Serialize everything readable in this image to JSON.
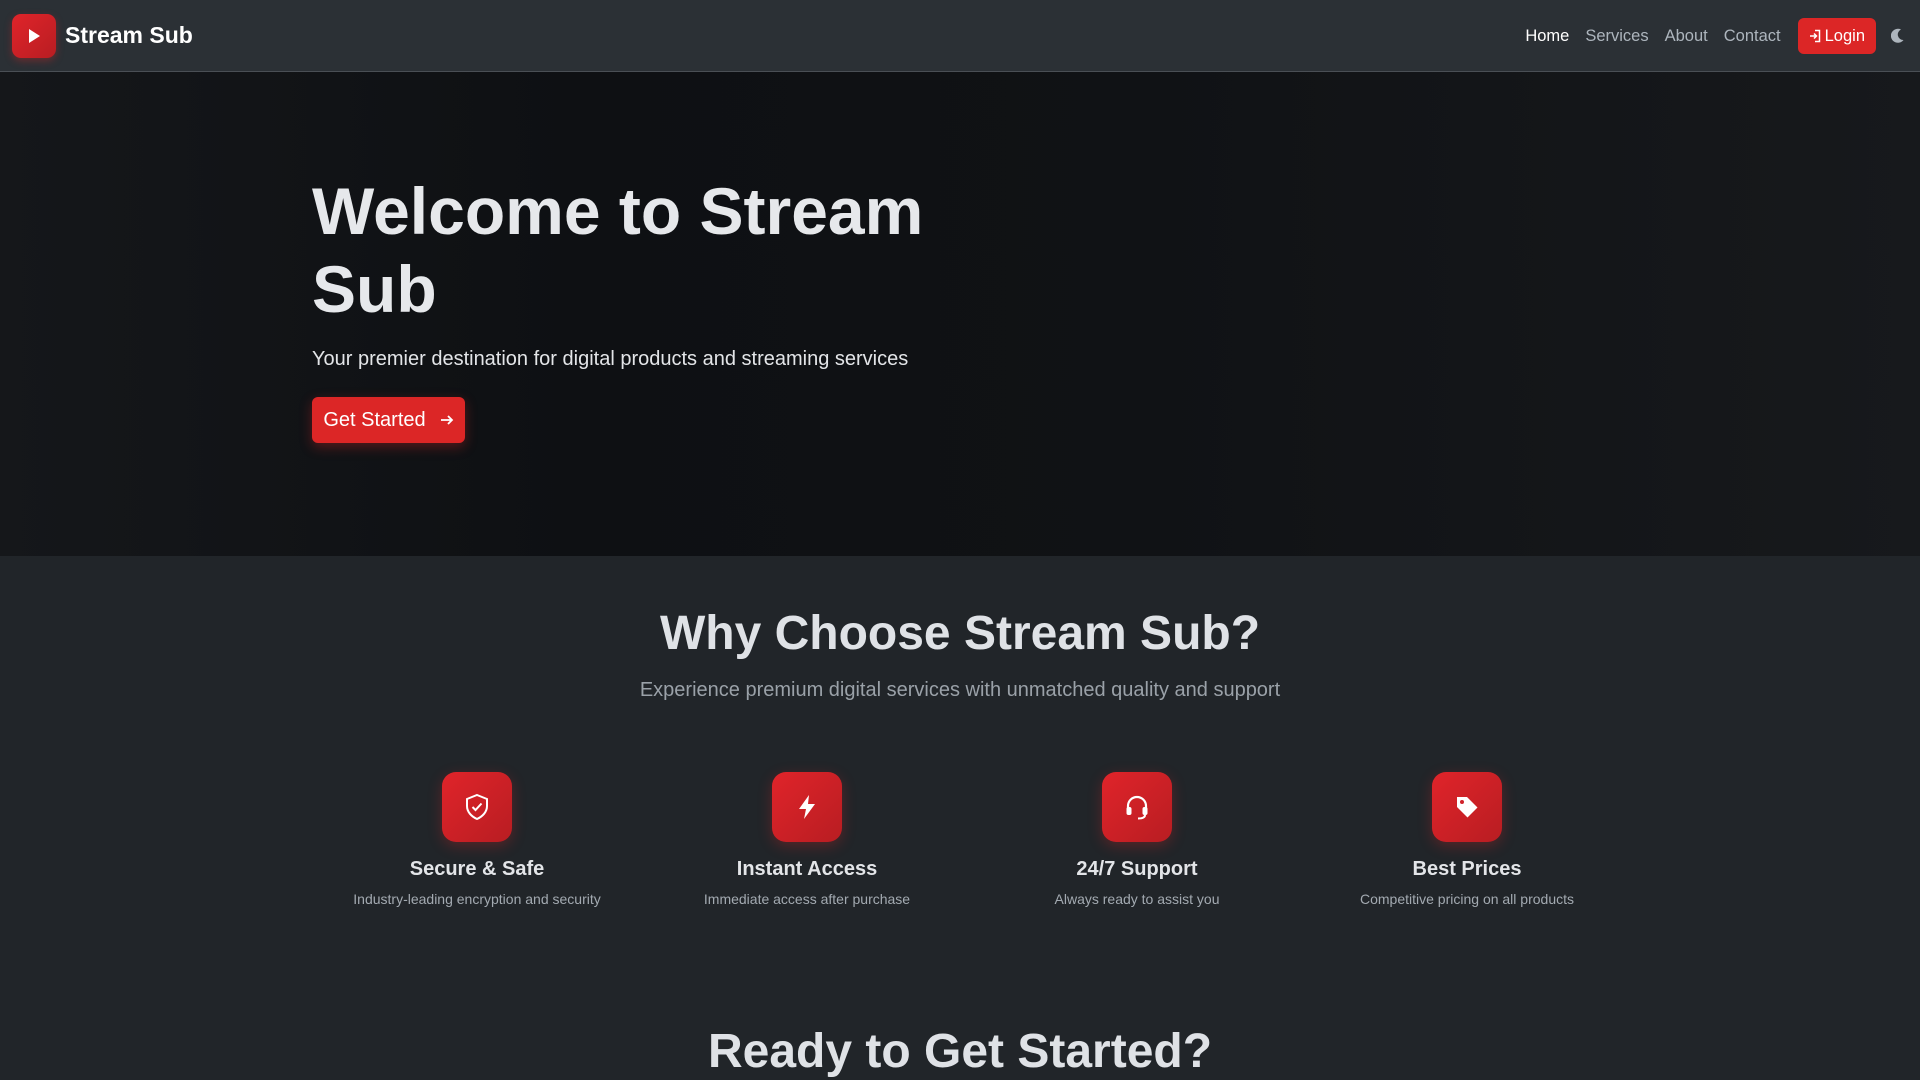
{
  "colors": {
    "accent": "#dc2626",
    "background": "#212529",
    "navbar": "#2b3035"
  },
  "navbar": {
    "brand_icon": "play-icon",
    "brand_name": "Stream Sub",
    "links": [
      "Home",
      "Services",
      "About",
      "Contact"
    ],
    "active_link": "Home",
    "login_icon": "login-icon",
    "login_label": "Login",
    "theme_toggle_icon": "moon-icon"
  },
  "hero": {
    "title": "Welcome to Stream Sub",
    "subtitle": "Your premier destination for digital products and streaming services",
    "cta_label": "Get Started",
    "cta_icon": "arrow-right-icon"
  },
  "features": {
    "title": "Why Choose Stream Sub?",
    "subtitle": "Experience premium digital services with unmatched quality and support",
    "items": [
      {
        "icon": "shield-icon",
        "title": "Secure & Safe",
        "description": "Industry-leading encryption and security"
      },
      {
        "icon": "lightning-icon",
        "title": "Instant Access",
        "description": "Immediate access after purchase"
      },
      {
        "icon": "headset-icon",
        "title": "24/7 Support",
        "description": "Always ready to assist you"
      },
      {
        "icon": "tag-icon",
        "title": "Best Prices",
        "description": "Competitive pricing on all products"
      }
    ]
  },
  "cta_section": {
    "title": "Ready to Get Started?"
  }
}
